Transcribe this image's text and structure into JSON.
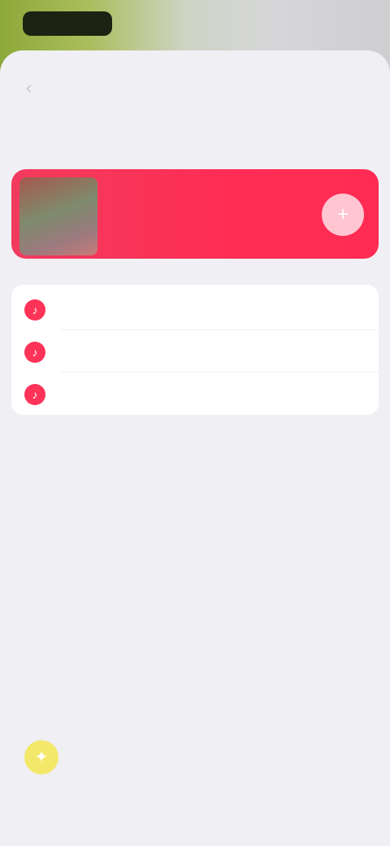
{
  "status": {
    "time": ""
  },
  "nav": {
    "back_glyph": "‹",
    "back_icon": "chevron-left-icon",
    "action_label": ""
  },
  "page": {
    "title": ""
  },
  "hero": {
    "title": "",
    "subtitle": "",
    "button_glyph": "+",
    "button_icon": "plus-icon",
    "accent_color": "#ff2d55"
  },
  "options": {
    "items": [
      {
        "label": "",
        "icon": "music-note-icon",
        "glyph": "♪"
      },
      {
        "label": "",
        "icon": "music-note-icon",
        "glyph": "♪"
      },
      {
        "label": "",
        "icon": "music-note-icon",
        "glyph": "♪"
      }
    ]
  },
  "footer": {
    "icon": "lightbulb-icon",
    "glyph": "✦",
    "text": ""
  }
}
